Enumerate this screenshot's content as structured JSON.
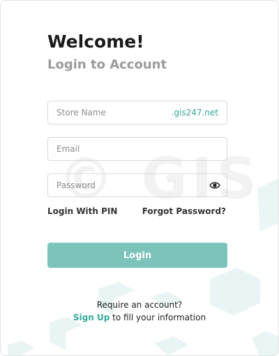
{
  "header": {
    "title": "Welcome!",
    "subtitle": "Login to Account"
  },
  "form": {
    "store_name": {
      "placeholder": "Store Name",
      "suffix": ".gis247.net",
      "value": ""
    },
    "email": {
      "placeholder": "Email",
      "value": ""
    },
    "password": {
      "placeholder": "Password",
      "value": ""
    }
  },
  "links": {
    "login_with_pin": "Login With PIN",
    "forgot_password": "Forgot Password?"
  },
  "login_button": "Login",
  "footer": {
    "require_text": "Require an account?",
    "signup_link": "Sign Up",
    "signup_rest": " to fill your information"
  },
  "watermark": "© GIS",
  "colors": {
    "accent": "#34a89b",
    "button": "#7cc4bb",
    "decor": "#e6f4f3"
  },
  "icons": {
    "password_toggle": "eye-icon"
  }
}
